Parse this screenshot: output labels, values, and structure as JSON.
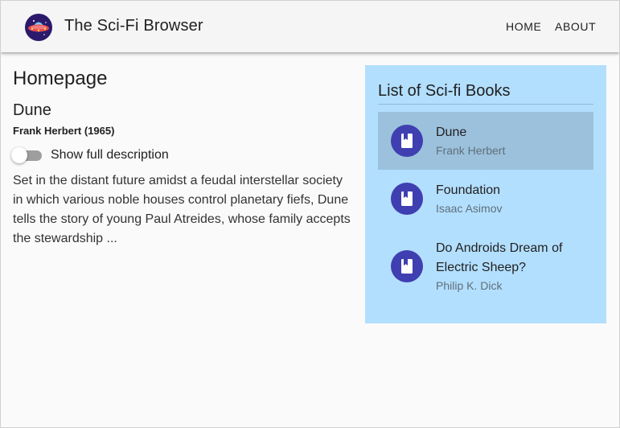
{
  "app": {
    "title": "The Sci-Fi Browser",
    "logo_icon": "flying-saucer-icon"
  },
  "nav": {
    "home_label": "HOME",
    "about_label": "ABOUT"
  },
  "main": {
    "heading": "Homepage",
    "book": {
      "title": "Dune",
      "meta": "Frank Herbert (1965)",
      "toggle_label": "Show full description",
      "toggle_on": false,
      "description": "Set in the distant future amidst a feudal interstellar society in which various noble houses control planetary fiefs, Dune tells the story of young Paul Atreides, whose family accepts the stewardship ..."
    }
  },
  "sidebar": {
    "title": "List of Sci-fi Books",
    "items": [
      {
        "title": "Dune",
        "author": "Frank Herbert",
        "icon": "book-icon",
        "selected": true
      },
      {
        "title": "Foundation",
        "author": "Isaac Asimov",
        "icon": "book-icon",
        "selected": false
      },
      {
        "title": "Do Androids Dream of Electric Sheep?",
        "author": "Philip K. Dick",
        "icon": "book-icon",
        "selected": false
      }
    ]
  },
  "colors": {
    "panel_background": "#b3dffe",
    "selected_item": "#9cc1dc",
    "avatar": "#3f3fb1",
    "toolbar": "#f5f5f5"
  }
}
